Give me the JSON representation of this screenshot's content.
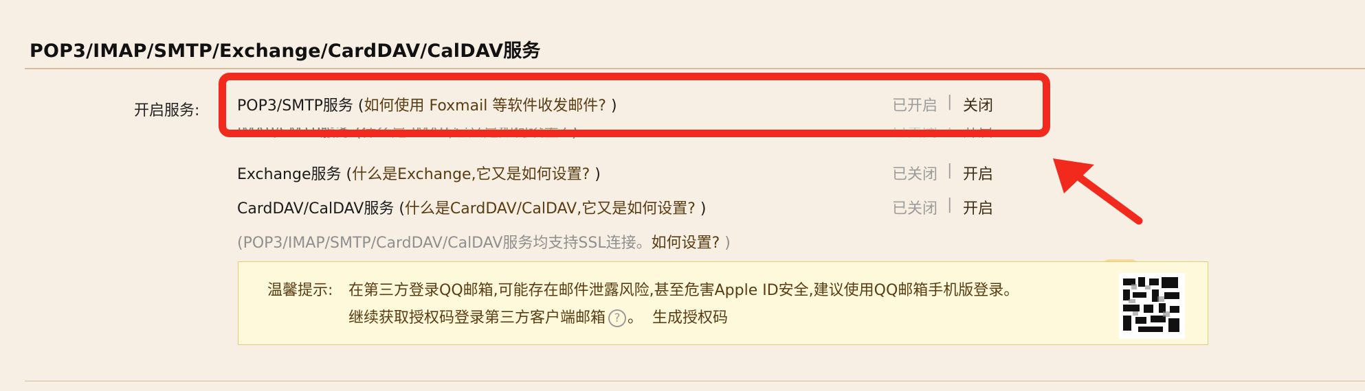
{
  "section": {
    "title": "POP3/IMAP/SMTP/Exchange/CardDAV/CalDAV服务"
  },
  "enable_label": "开启服务:",
  "services": [
    {
      "name": "POP3/SMTP服务",
      "help_open": " (",
      "help": "如何使用 Foxmail 等软件收发邮件?",
      "help_close": " )",
      "status": "已开启",
      "separator": "|",
      "action": "关闭"
    },
    {
      "name": "IMAP/SMTP服务",
      "help_open": " (",
      "help": "什么是 IMAP,它又是如何设置?",
      "help_close": " )",
      "status": "已关闭",
      "separator": "|",
      "action": "开启"
    },
    {
      "name": "Exchange服务",
      "help_open": " (",
      "help": "什么是Exchange,它又是如何设置?",
      "help_close": " )",
      "status": "已关闭",
      "separator": "|",
      "action": "开启"
    },
    {
      "name": "CardDAV/CalDAV服务",
      "help_open": " (",
      "help": "什么是CardDAV/CalDAV,它又是如何设置?",
      "help_close": " )",
      "status": "已关闭",
      "separator": "|",
      "action": "开启"
    }
  ],
  "ssl_note": {
    "text": "(POP3/IMAP/SMTP/CardDAV/CalDAV服务均支持SSL连接。",
    "link": "如何设置?",
    "close": " )"
  },
  "tip": {
    "label": "温馨提示:",
    "line1": "在第三方登录QQ邮箱,可能存在邮件泄露风险,甚至危害Apple ID安全,建议使用QQ邮箱手机版登录。",
    "line2": "继续获取授权码登录第三方客户端邮箱",
    "help_icon": "?",
    "line2_suffix": "。",
    "generate_link": "生成授权码"
  },
  "colors": {
    "highlight": "#f22a1e",
    "background": "#f7efe4",
    "link": "#5a3c12"
  },
  "icons": {
    "help": "question-circle-icon",
    "qr": "qr-code-icon",
    "arrow": "red-arrow-annotation"
  }
}
